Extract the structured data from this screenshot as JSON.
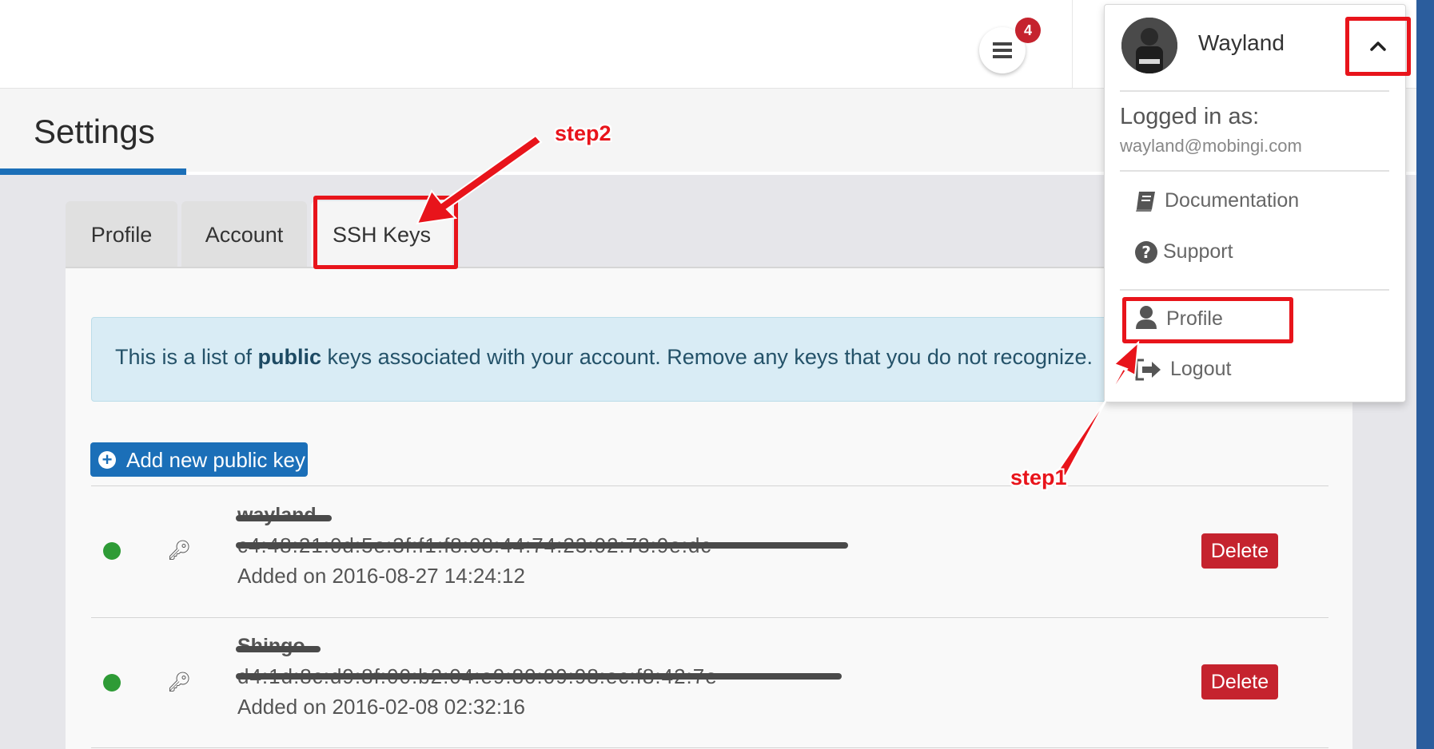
{
  "topbar": {
    "notifications_count": "4"
  },
  "page": {
    "title": "Settings"
  },
  "tabs": [
    {
      "label": "Profile",
      "active": false
    },
    {
      "label": "Account",
      "active": false
    },
    {
      "label": "SSH Keys",
      "active": true
    }
  ],
  "info": {
    "text_before": "This is a list of ",
    "text_bold": "public",
    "text_after": " keys associated with your account. Remove any keys that you do not recognize."
  },
  "add_key_button": {
    "label": "Add new public key"
  },
  "keys": [
    {
      "name": "wayland",
      "fingerprint": "c4:48:21:0d:5e:3f:f1:f8:08:44:74:23:02:73:9e:dc",
      "added": "Added on 2016-08-27 14:24:12",
      "status": "active",
      "delete_label": "Delete"
    },
    {
      "name": "Shingo",
      "fingerprint": "d4:1d:8c:d9:8f:00:b2:04:e9:80:09:98:ec:f8:42:7e",
      "added": "Added on 2016-02-08 02:32:16",
      "status": "active",
      "delete_label": "Delete"
    }
  ],
  "user_menu": {
    "user_name": "Wayland",
    "logged_in_label": "Logged in as:",
    "email": "wayland@mobingi.com",
    "items": [
      {
        "label": "Documentation",
        "icon": "book-icon"
      },
      {
        "label": "Support",
        "icon": "question-circle-icon"
      },
      {
        "label": "Profile",
        "icon": "user-icon"
      },
      {
        "label": "Logout",
        "icon": "sign-out-icon"
      }
    ]
  },
  "annotations": {
    "step1": "step1",
    "step2": "step2",
    "color": "#e8141b"
  },
  "colors": {
    "primary": "#1b6fb8",
    "danger": "#c5232e",
    "success": "#2e9b36",
    "info_bg": "#d9ecf5"
  }
}
